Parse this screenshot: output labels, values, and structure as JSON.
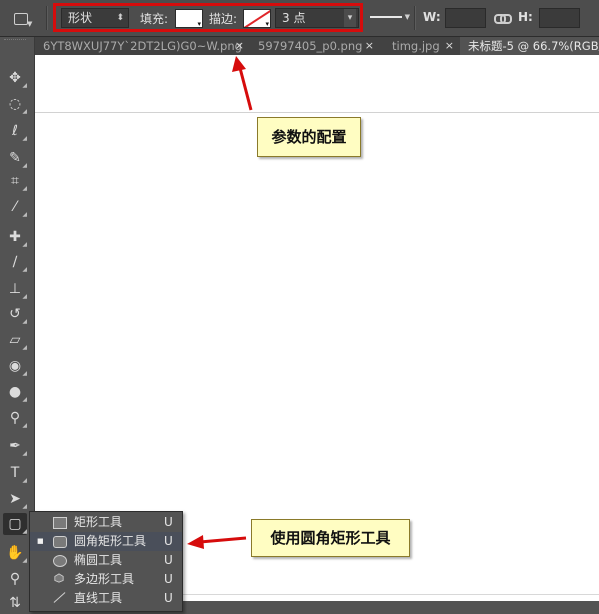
{
  "options_bar": {
    "tool_preset_icon": "rounded-rect-tool-icon",
    "mode_value": "形状",
    "fill_label": "填充:",
    "fill_color": "#ffffff",
    "stroke_label": "描边:",
    "stroke_color": "none",
    "stroke_width_value": "3 点",
    "width_label": "W:",
    "height_label": "H:",
    "link_icon": "link-icon",
    "highlight_color": "#d60c0c"
  },
  "tabs": [
    {
      "label": "6YT8WXUJ77Y`2DT2LG)G0~W.png",
      "close": "×",
      "active": false
    },
    {
      "label": "59797405_p0.png",
      "close": "×",
      "active": false
    },
    {
      "label": "timg.jpg",
      "close": "×",
      "active": false
    },
    {
      "label": "未标题-5 @ 66.7%(RGB/",
      "close": "",
      "active": true
    }
  ],
  "toolbox": {
    "tools": [
      {
        "name": "move-tool-icon",
        "glyph": "✥"
      },
      {
        "name": "marquee-tool-icon",
        "glyph": "◌"
      },
      {
        "name": "lasso-tool-icon",
        "glyph": "ℓ"
      },
      {
        "name": "quick-selection-tool-icon",
        "glyph": "✎"
      },
      {
        "name": "crop-tool-icon",
        "glyph": "⌗"
      },
      {
        "name": "eyedropper-tool-icon",
        "glyph": "⁄"
      },
      {
        "name": "healing-brush-tool-icon",
        "glyph": "✚"
      },
      {
        "name": "brush-tool-icon",
        "glyph": "∕"
      },
      {
        "name": "clone-stamp-tool-icon",
        "glyph": "⊥"
      },
      {
        "name": "history-brush-tool-icon",
        "glyph": "↺"
      },
      {
        "name": "eraser-tool-icon",
        "glyph": "▱"
      },
      {
        "name": "paint-bucket-tool-icon",
        "glyph": "◉"
      },
      {
        "name": "blur-tool-icon",
        "glyph": "●"
      },
      {
        "name": "dodge-tool-icon",
        "glyph": "⚲"
      },
      {
        "name": "pen-tool-icon",
        "glyph": "✒"
      },
      {
        "name": "type-tool-icon",
        "glyph": "T"
      },
      {
        "name": "path-selection-tool-icon",
        "glyph": "➤"
      },
      {
        "name": "shape-tool-icon",
        "glyph": "▢"
      },
      {
        "name": "hand-tool-icon",
        "glyph": "✋"
      },
      {
        "name": "zoom-tool-icon",
        "glyph": "⚲"
      },
      {
        "name": "swap-colors-icon",
        "glyph": "⇅"
      }
    ]
  },
  "flyout": {
    "items": [
      {
        "label": "矩形工具",
        "shortcut": "U",
        "icon": "rectangle-icon",
        "selected": false
      },
      {
        "label": "圆角矩形工具",
        "shortcut": "U",
        "icon": "rounded-rectangle-icon",
        "selected": true
      },
      {
        "label": "椭圆工具",
        "shortcut": "U",
        "icon": "ellipse-icon",
        "selected": false
      },
      {
        "label": "多边形工具",
        "shortcut": "U",
        "icon": "polygon-icon",
        "selected": false
      },
      {
        "label": "直线工具",
        "shortcut": "U",
        "icon": "line-icon",
        "selected": false
      }
    ],
    "selected_bullet": "■"
  },
  "annotations": {
    "params_callout": "参数的配置",
    "rounded_rect_callout": "使用圆角矩形工具",
    "arrow_color": "#d60c0c"
  }
}
